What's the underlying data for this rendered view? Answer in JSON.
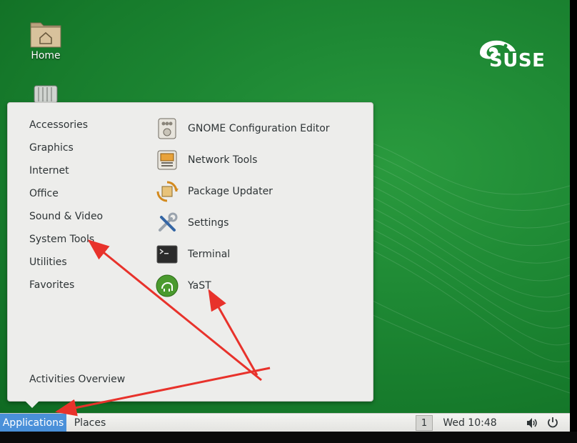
{
  "desktop": {
    "icons": [
      {
        "label": "Home",
        "icon": "home-folder-icon"
      },
      {
        "label": "",
        "icon": "trash-icon"
      }
    ],
    "logo": {
      "word": "SUSE"
    }
  },
  "menu": {
    "categories": [
      {
        "label": "Accessories"
      },
      {
        "label": "Graphics"
      },
      {
        "label": "Internet"
      },
      {
        "label": "Office"
      },
      {
        "label": "Sound & Video"
      },
      {
        "label": "System Tools"
      },
      {
        "label": "Utilities"
      },
      {
        "label": "Favorites"
      }
    ],
    "activities_label": "Activities Overview",
    "apps": [
      {
        "label": "GNOME Configuration Editor",
        "icon": "config-editor-icon"
      },
      {
        "label": "Network Tools",
        "icon": "network-tools-icon"
      },
      {
        "label": "Package Updater",
        "icon": "package-updater-icon"
      },
      {
        "label": "Settings",
        "icon": "settings-tools-icon"
      },
      {
        "label": "Terminal",
        "icon": "terminal-icon"
      },
      {
        "label": "YaST",
        "icon": "yast-icon"
      }
    ]
  },
  "panel": {
    "applications_label": "Applications",
    "places_label": "Places",
    "workspace": "1",
    "clock": "Wed 10:48",
    "volume_icon": "volume-icon",
    "power_icon": "power-icon"
  },
  "colors": {
    "desktop_green": "#1f8a35",
    "accent_blue": "#4a90d9",
    "annotation_red": "#e8322b",
    "menu_bg": "#ededeb"
  }
}
